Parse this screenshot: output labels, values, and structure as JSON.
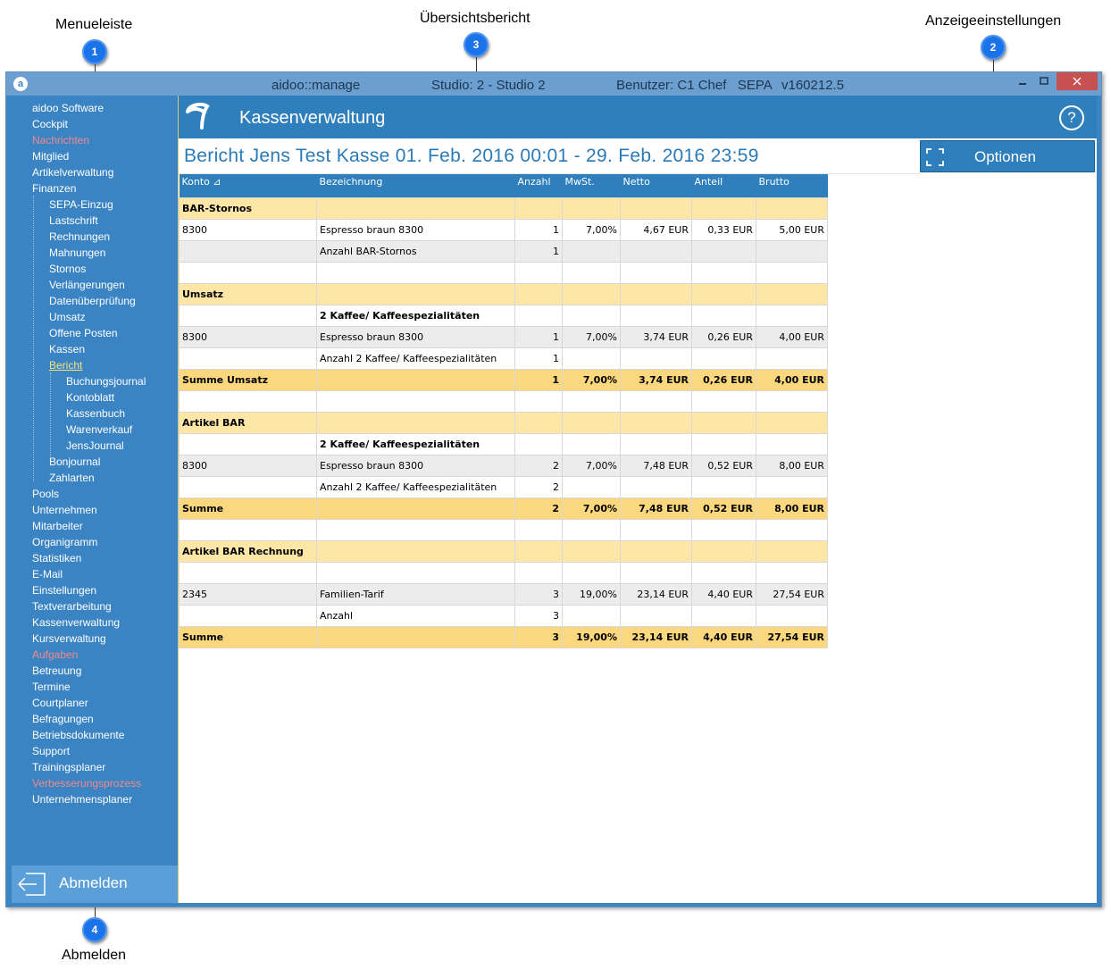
{
  "callouts": {
    "menu": {
      "label": "Menueleiste",
      "number": "1"
    },
    "overview": {
      "label": "Übersichtsbericht",
      "number": "3"
    },
    "display": {
      "label": "Anzeigeeinstellungen",
      "number": "2"
    },
    "logout": {
      "label": "Abmelden",
      "number": "4"
    }
  },
  "titlebar": {
    "app": "aidoo::manage",
    "studio": "Studio: 2 - Studio 2",
    "user": "Benutzer: C1 Chef   SEPA",
    "version": "v160212.5"
  },
  "sidebar": {
    "items": [
      {
        "label": "aidoo Software",
        "level": 0,
        "style": "normal"
      },
      {
        "label": "Cockpit",
        "level": 0,
        "style": "normal"
      },
      {
        "label": "Nachrichten",
        "level": 0,
        "style": "red"
      },
      {
        "label": "Mitglied",
        "level": 0,
        "style": "normal"
      },
      {
        "label": "Artikelverwaltung",
        "level": 0,
        "style": "normal"
      },
      {
        "label": "Finanzen",
        "level": 0,
        "style": "normal"
      },
      {
        "label": "SEPA-Einzug",
        "level": 1,
        "style": "normal"
      },
      {
        "label": "Lastschrift",
        "level": 1,
        "style": "normal"
      },
      {
        "label": "Rechnungen",
        "level": 1,
        "style": "normal"
      },
      {
        "label": "Mahnungen",
        "level": 1,
        "style": "normal"
      },
      {
        "label": "Stornos",
        "level": 1,
        "style": "normal"
      },
      {
        "label": "Verlängerungen",
        "level": 1,
        "style": "normal"
      },
      {
        "label": "Datenüberprüfung",
        "level": 1,
        "style": "normal"
      },
      {
        "label": "Umsatz",
        "level": 1,
        "style": "normal"
      },
      {
        "label": "Offene Posten",
        "level": 1,
        "style": "normal"
      },
      {
        "label": "Kassen",
        "level": 1,
        "style": "normal"
      },
      {
        "label": "Bericht",
        "level": 1,
        "style": "active"
      },
      {
        "label": "Buchungsjournal",
        "level": 2,
        "style": "normal"
      },
      {
        "label": "Kontoblatt",
        "level": 2,
        "style": "normal"
      },
      {
        "label": "Kassenbuch",
        "level": 2,
        "style": "normal"
      },
      {
        "label": "Warenverkauf",
        "level": 2,
        "style": "normal"
      },
      {
        "label": "JensJournal",
        "level": 2,
        "style": "normal"
      },
      {
        "label": "Bonjournal",
        "level": 1,
        "style": "normal"
      },
      {
        "label": "Zahlarten",
        "level": 1,
        "style": "normal"
      },
      {
        "label": "Pools",
        "level": 0,
        "style": "normal"
      },
      {
        "label": "Unternehmen",
        "level": 0,
        "style": "normal"
      },
      {
        "label": "Mitarbeiter",
        "level": 0,
        "style": "normal"
      },
      {
        "label": "Organigramm",
        "level": 0,
        "style": "normal"
      },
      {
        "label": "Statistiken",
        "level": 0,
        "style": "normal"
      },
      {
        "label": "E-Mail",
        "level": 0,
        "style": "normal"
      },
      {
        "label": "Einstellungen",
        "level": 0,
        "style": "normal"
      },
      {
        "label": "Textverarbeitung",
        "level": 0,
        "style": "normal"
      },
      {
        "label": "Kassenverwaltung",
        "level": 0,
        "style": "normal"
      },
      {
        "label": "Kursverwaltung",
        "level": 0,
        "style": "normal"
      },
      {
        "label": "Aufgaben",
        "level": 0,
        "style": "red"
      },
      {
        "label": "Betreuung",
        "level": 0,
        "style": "normal"
      },
      {
        "label": "Termine",
        "level": 0,
        "style": "normal"
      },
      {
        "label": "Courtplaner",
        "level": 0,
        "style": "normal"
      },
      {
        "label": "Befragungen",
        "level": 0,
        "style": "normal"
      },
      {
        "label": "Betriebsdokumente",
        "level": 0,
        "style": "normal"
      },
      {
        "label": "Support",
        "level": 0,
        "style": "normal"
      },
      {
        "label": "Trainingsplaner",
        "level": 0,
        "style": "normal"
      },
      {
        "label": "Verbesserungsprozess",
        "level": 0,
        "style": "red"
      },
      {
        "label": "Unternehmensplaner",
        "level": 0,
        "style": "normal"
      }
    ],
    "logout_label": "Abmelden"
  },
  "main": {
    "module_title": "Kassenverwaltung",
    "help_symbol": "?",
    "report_title": "Bericht Jens Test Kasse 01. Feb. 2016 00:01 - 29. Feb. 2016 23:59",
    "options_label": "Optionen"
  },
  "table": {
    "headers": [
      "Konto ⊿",
      "Bezeichnung",
      "Anzahl",
      "MwSt.",
      "Netto",
      "Anteil",
      "Brutto"
    ],
    "rows": [
      {
        "type": "sect",
        "cells": [
          "BAR-Stornos",
          "",
          "",
          "",
          "",
          "",
          ""
        ]
      },
      {
        "type": "white",
        "cells": [
          "8300",
          "Espresso braun 8300",
          "1",
          "7,00%",
          "4,67 EUR",
          "0,33 EUR",
          "5,00 EUR"
        ]
      },
      {
        "type": "grey",
        "cells": [
          "",
          "Anzahl BAR-Stornos",
          "1",
          "",
          "",
          "",
          ""
        ]
      },
      {
        "type": "white",
        "cells": [
          "",
          "",
          "",
          "",
          "",
          "",
          ""
        ]
      },
      {
        "type": "sect",
        "cells": [
          "Umsatz",
          "",
          "",
          "",
          "",
          "",
          ""
        ]
      },
      {
        "type": "bold",
        "cells": [
          "",
          "2 Kaffee/ Kaffeespezialitäten",
          "",
          "",
          "",
          "",
          ""
        ]
      },
      {
        "type": "grey",
        "cells": [
          "8300",
          "Espresso braun 8300",
          "1",
          "7,00%",
          "3,74 EUR",
          "0,26 EUR",
          "4,00 EUR"
        ]
      },
      {
        "type": "white",
        "cells": [
          "",
          "Anzahl 2 Kaffee/ Kaffeespezialitäten",
          "1",
          "",
          "",
          "",
          ""
        ]
      },
      {
        "type": "sum",
        "cells": [
          "Summe Umsatz",
          "",
          "1",
          "7,00%",
          "3,74 EUR",
          "0,26 EUR",
          "4,00 EUR"
        ]
      },
      {
        "type": "white",
        "cells": [
          "",
          "",
          "",
          "",
          "",
          "",
          ""
        ]
      },
      {
        "type": "sect",
        "cells": [
          "Artikel BAR",
          "",
          "",
          "",
          "",
          "",
          ""
        ]
      },
      {
        "type": "bold",
        "cells": [
          "",
          "2 Kaffee/ Kaffeespezialitäten",
          "",
          "",
          "",
          "",
          ""
        ]
      },
      {
        "type": "grey",
        "cells": [
          "8300",
          "Espresso braun 8300",
          "2",
          "7,00%",
          "7,48 EUR",
          "0,52 EUR",
          "8,00 EUR"
        ]
      },
      {
        "type": "white",
        "cells": [
          "",
          "Anzahl 2 Kaffee/ Kaffeespezialitäten",
          "2",
          "",
          "",
          "",
          ""
        ]
      },
      {
        "type": "sum",
        "cells": [
          "Summe",
          "",
          "2",
          "7,00%",
          "7,48 EUR",
          "0,52 EUR",
          "8,00 EUR"
        ]
      },
      {
        "type": "white",
        "cells": [
          "",
          "",
          "",
          "",
          "",
          "",
          ""
        ]
      },
      {
        "type": "sect",
        "cells": [
          "Artikel BAR Rechnung",
          "",
          "",
          "",
          "",
          "",
          ""
        ]
      },
      {
        "type": "white",
        "cells": [
          "",
          "",
          "",
          "",
          "",
          "",
          ""
        ]
      },
      {
        "type": "grey",
        "cells": [
          "2345",
          "Familien-Tarif",
          "3",
          "19,00%",
          "23,14 EUR",
          "4,40 EUR",
          "27,54 EUR"
        ]
      },
      {
        "type": "white",
        "cells": [
          "",
          "Anzahl",
          "3",
          "",
          "",
          "",
          ""
        ]
      },
      {
        "type": "sum",
        "cells": [
          "Summe",
          "",
          "3",
          "19,00%",
          "23,14 EUR",
          "4,40 EUR",
          "27,54 EUR"
        ]
      }
    ]
  }
}
